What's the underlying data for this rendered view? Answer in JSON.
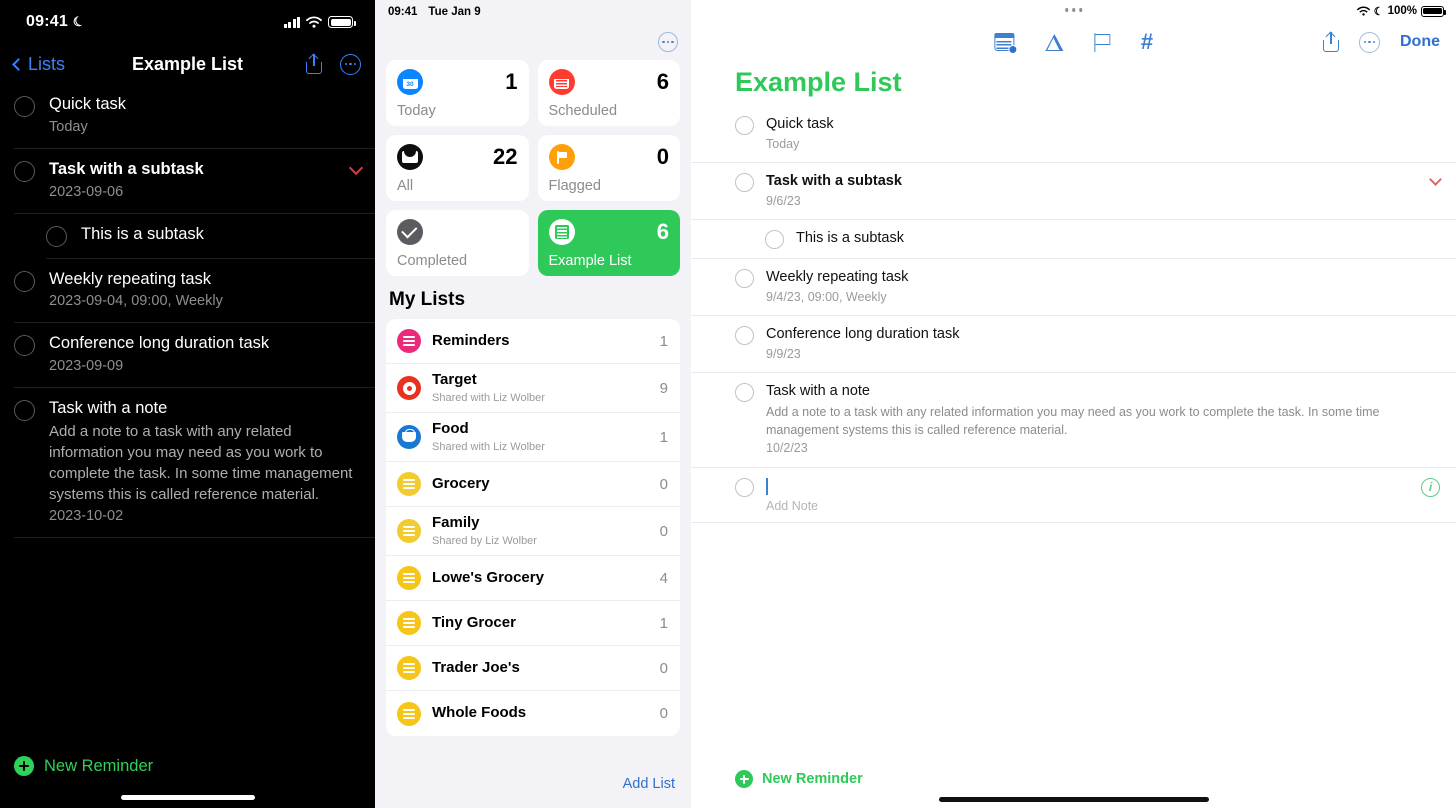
{
  "left": {
    "status": {
      "time": "09:41",
      "moon_icon": "moon-icon",
      "signal_icon": "cellular-bars-icon",
      "wifi_icon": "wifi-icon",
      "battery_icon": "battery-icon"
    },
    "nav": {
      "back_label": "Lists",
      "title": "Example List",
      "share_icon": "share-icon",
      "more_icon": "ellipsis-circle-icon"
    },
    "tasks": [
      {
        "title": "Quick task",
        "sub": "Today",
        "bold": false,
        "sub_indent": false
      },
      {
        "title": "Task with a subtask",
        "sub": "2023-09-06",
        "bold": true,
        "has_chevron": true
      },
      {
        "title": "This is a subtask",
        "sub": "",
        "bold": false,
        "is_sub": true
      },
      {
        "title": "Weekly repeating task",
        "sub": "2023-09-04, 09:00, Weekly",
        "bold": false
      },
      {
        "title": "Conference long duration task",
        "sub": "2023-09-09",
        "bold": false
      },
      {
        "title": "Task with a note",
        "note": "Add a note to a task with any related information you may need as you work to complete the task. In some time management systems this is called reference material.",
        "sub": "2023-10-02",
        "bold": false
      }
    ],
    "new_reminder_label": "New Reminder"
  },
  "middle": {
    "status": {
      "time": "09:41",
      "date": "Tue Jan 9"
    },
    "more_icon": "ellipsis-circle-icon",
    "smart_cards": [
      {
        "label": "Today",
        "count": "1",
        "icon": "calendar-icon",
        "color": "#0a84ff",
        "selected": false
      },
      {
        "label": "Scheduled",
        "count": "6",
        "icon": "calendar-red-icon",
        "color": "#ff3b30",
        "selected": false
      },
      {
        "label": "All",
        "count": "22",
        "icon": "inbox-icon",
        "color": "#0e0e0e",
        "selected": false
      },
      {
        "label": "Flagged",
        "count": "0",
        "icon": "flag-icon",
        "color": "#ff9f0a",
        "selected": false
      },
      {
        "label": "Completed",
        "count": "",
        "icon": "checkmark-icon",
        "color": "#5b5b60",
        "selected": false
      },
      {
        "label": "Example List",
        "count": "6",
        "icon": "building-icon",
        "color": "#2fc95a",
        "selected": true
      }
    ],
    "my_lists_header": "My Lists",
    "lists": [
      {
        "name": "Reminders",
        "sharer": "",
        "count": "1",
        "icon": "list-lines-icon",
        "color": "#ec2a7b"
      },
      {
        "name": "Target",
        "sharer": "Shared with Liz Wolber",
        "count": "9",
        "icon": "donut-icon",
        "color": "#e8321f"
      },
      {
        "name": "Food",
        "sharer": "Shared with Liz Wolber",
        "count": "1",
        "icon": "basket-icon",
        "color": "#1878d4"
      },
      {
        "name": "Grocery",
        "sharer": "",
        "count": "0",
        "icon": "list-lines-icon",
        "color": "#f2cb2f"
      },
      {
        "name": "Family",
        "sharer": "Shared by Liz Wolber",
        "count": "0",
        "icon": "list-lines-icon",
        "color": "#f2cb2f"
      },
      {
        "name": "Lowe's Grocery",
        "sharer": "",
        "count": "4",
        "icon": "list-lines-icon",
        "color": "#f5c518"
      },
      {
        "name": "Tiny Grocer",
        "sharer": "",
        "count": "1",
        "icon": "list-lines-icon",
        "color": "#f5c518"
      },
      {
        "name": "Trader Joe's",
        "sharer": "",
        "count": "0",
        "icon": "list-lines-icon",
        "color": "#f5c518"
      },
      {
        "name": "Whole Foods",
        "sharer": "",
        "count": "0",
        "icon": "list-lines-icon",
        "color": "#f5c518"
      }
    ],
    "add_list_label": "Add List"
  },
  "right": {
    "status": {
      "battery_label": "100%",
      "wifi_icon": "wifi-icon",
      "moon_icon": "moon-icon",
      "battery_icon": "battery-icon"
    },
    "toolbar": {
      "calendar_icon": "calendar-clock-icon",
      "location_icon": "location-arrow-icon",
      "flag_icon": "flag-icon",
      "tag_icon": "hashtag-icon",
      "share_icon": "share-icon",
      "more_icon": "ellipsis-circle-icon",
      "done_label": "Done"
    },
    "title": "Example List",
    "title_color": "#2fc95a",
    "tasks": [
      {
        "title": "Quick task",
        "sub": "Today",
        "bold": false
      },
      {
        "title": "Task with a subtask",
        "sub": "9/6/23",
        "bold": true,
        "has_chevron": true
      },
      {
        "title": "This is a subtask",
        "sub": "",
        "bold": false,
        "is_sub": true
      },
      {
        "title": "Weekly repeating task",
        "sub": "9/4/23, 09:00, Weekly",
        "bold": false
      },
      {
        "title": "Conference long duration task",
        "sub": "9/9/23",
        "bold": false
      },
      {
        "title": "Task with a note",
        "note": "Add a note to a task with any related information you may need as you work to complete the task. In some time management systems this is called reference material.",
        "sub": "10/2/23",
        "bold": false
      }
    ],
    "add_row": {
      "value": "",
      "note_placeholder": "Add Note",
      "info_icon": "info-circle-icon"
    },
    "new_reminder_label": "New Reminder"
  }
}
